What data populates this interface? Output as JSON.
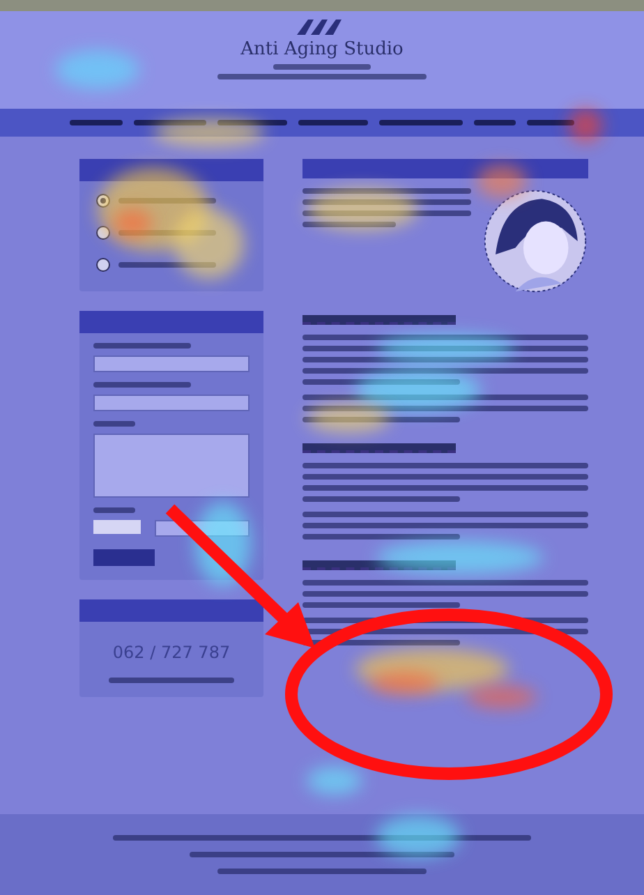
{
  "header": {
    "site_title": "Anti Aging Studio"
  },
  "sidebar": {
    "radio_options": [
      {
        "selected": true
      },
      {
        "selected": false
      },
      {
        "selected": false
      }
    ],
    "contact_panel": {
      "phone": "062 / 727 787"
    }
  },
  "annotation": {
    "arrow": true,
    "ellipse": true
  }
}
